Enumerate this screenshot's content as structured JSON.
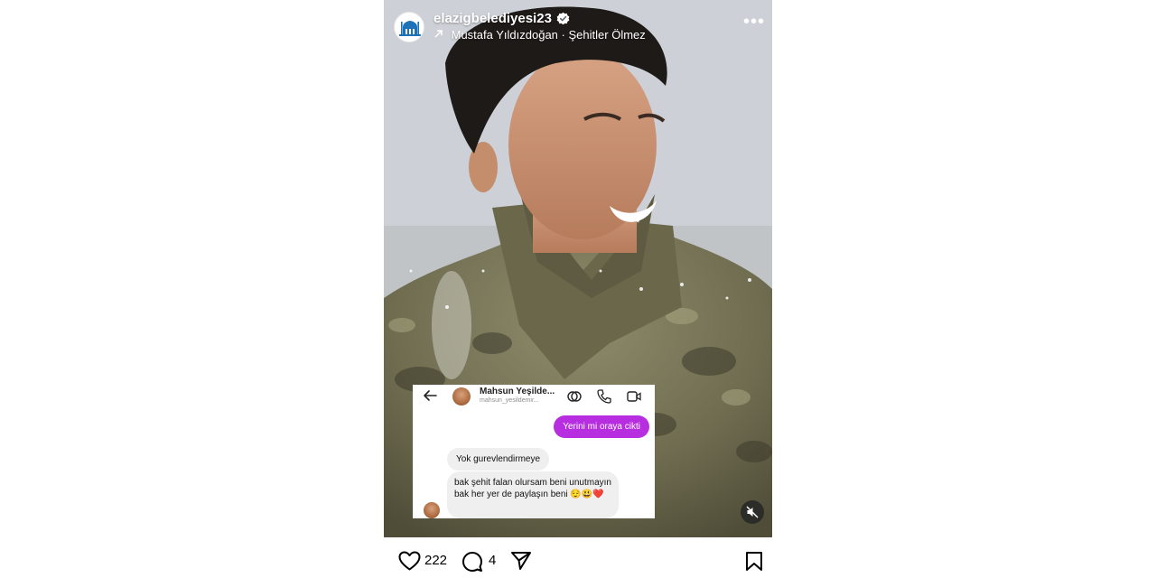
{
  "post": {
    "username": "elazigbelediyesi23",
    "audio_artist": "Mustafa Yıldızdoğan",
    "audio_separator": "·",
    "audio_title": "Şehitler Ölmez",
    "more_label": "•••"
  },
  "chat": {
    "name": "Mahsun Yeşilde...",
    "handle": "mahsun_yesildemir...",
    "messages": [
      {
        "sender": "me",
        "text": "Yerini mi oraya cikti"
      },
      {
        "sender": "them",
        "text": "Yok gurevlendirmeye"
      },
      {
        "sender": "them",
        "text": "bak şehit falan olursam beni unutmayın bak her yer de paylaşın beni 😌😃❤️"
      }
    ]
  },
  "actions": {
    "likes": "222",
    "comments": "4"
  },
  "colors": {
    "outgoing_bubble": "#b62ee0",
    "incoming_bubble": "#efefef"
  },
  "icons": [
    "verified-badge-icon",
    "arrow-up-right-icon",
    "more-icon",
    "back-arrow-icon",
    "link-icon",
    "phone-icon",
    "video-icon",
    "mute-icon",
    "heart-icon",
    "comment-icon",
    "send-icon",
    "bookmark-icon"
  ]
}
